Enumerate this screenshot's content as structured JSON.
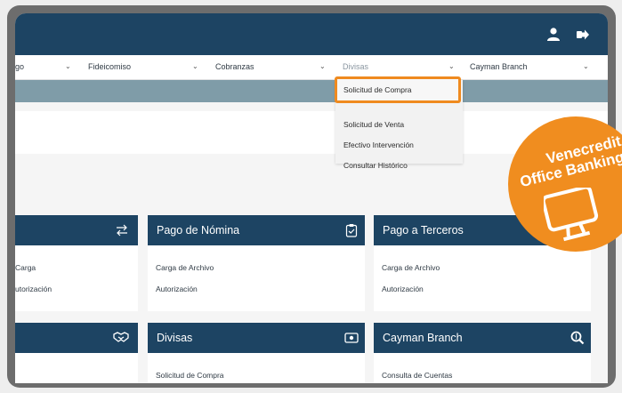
{
  "nav": {
    "items": [
      {
        "label": "go"
      },
      {
        "label": "Fideicomiso"
      },
      {
        "label": "Cobranzas"
      },
      {
        "label": "Divisas"
      },
      {
        "label": "Cayman Branch"
      }
    ],
    "chevron": "⌄"
  },
  "dropdown": {
    "items": [
      "Solicitud de Compra",
      "Solicitud de Venta",
      "Efectivo Intervención",
      "Consultar Histórico"
    ]
  },
  "cards": {
    "row1": [
      {
        "title": "",
        "links": [
          "Carga",
          "utorización"
        ],
        "icon": "arrows-exchange-icon"
      },
      {
        "title": "Pago de Nómina",
        "links": [
          "Carga de Archivo",
          "Autorización"
        ],
        "icon": "clipboard-check-icon"
      },
      {
        "title": "Pago a Terceros",
        "links": [
          "Carga de Archivo",
          "Autorización"
        ],
        "icon": ""
      }
    ],
    "row2": [
      {
        "title": "",
        "links": [],
        "icon": "handshake-icon"
      },
      {
        "title": "Divisas",
        "links": [
          "Solicitud de Compra"
        ],
        "icon": "money-bill-icon"
      },
      {
        "title": "Cayman Branch",
        "links": [
          "Consulta de Cuentas"
        ],
        "icon": "search-dollar-icon"
      }
    ]
  },
  "badge": {
    "line1": "Venecredit",
    "line2": "Office Banking"
  },
  "colors": {
    "primary": "#1d4463",
    "accent": "#ef8a1f",
    "teal": "#7f9ca8"
  }
}
